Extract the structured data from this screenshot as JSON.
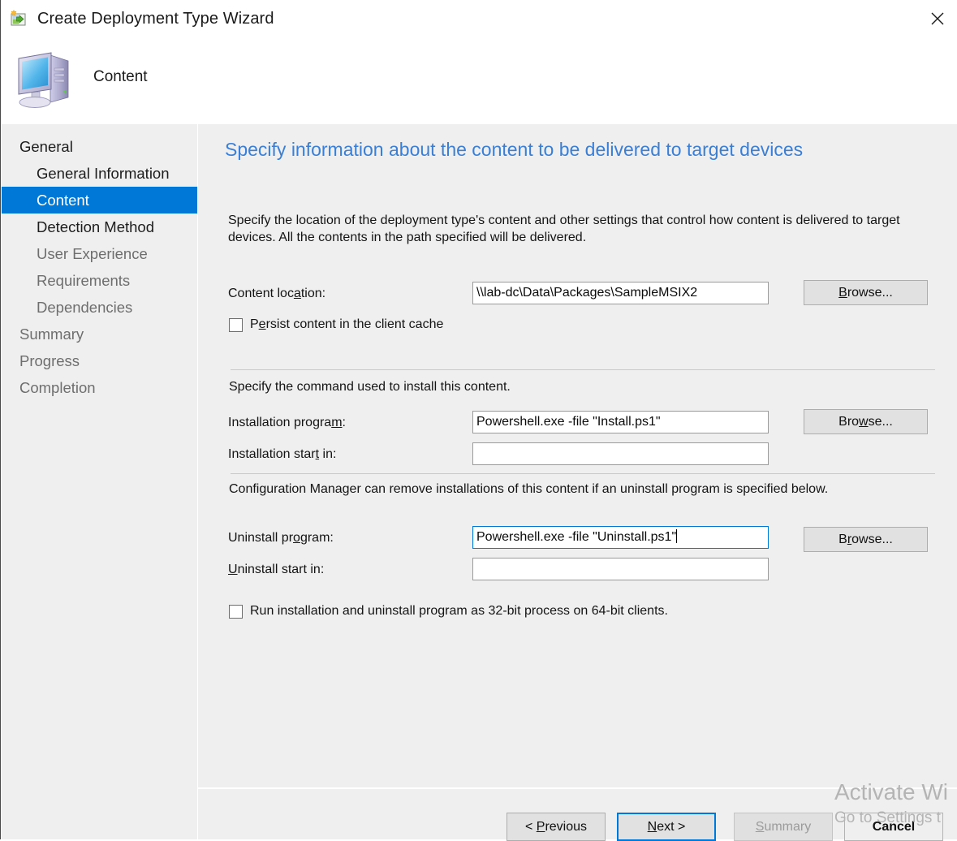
{
  "window": {
    "title": "Create Deployment Type Wizard",
    "title_icon": "deployment-type-icon",
    "close_icon": "close-icon"
  },
  "banner": {
    "icon": "computer-monitor-icon",
    "title": "Content"
  },
  "sidebar": {
    "items": [
      {
        "label": "General",
        "level": 0,
        "state": "normal"
      },
      {
        "label": "General Information",
        "level": 1,
        "state": "normal"
      },
      {
        "label": "Content",
        "level": 1,
        "state": "selected"
      },
      {
        "label": "Detection Method",
        "level": 1,
        "state": "normal"
      },
      {
        "label": "User Experience",
        "level": 1,
        "state": "dim"
      },
      {
        "label": "Requirements",
        "level": 1,
        "state": "dim"
      },
      {
        "label": "Dependencies",
        "level": 1,
        "state": "dim"
      },
      {
        "label": "Summary",
        "level": 0,
        "state": "dim"
      },
      {
        "label": "Progress",
        "level": 0,
        "state": "dim"
      },
      {
        "label": "Completion",
        "level": 0,
        "state": "dim"
      }
    ]
  },
  "main": {
    "heading": "Specify information about the content to be delivered to target devices",
    "intro": "Specify the location of the deployment type's content and other settings that control how content is delivered to target devices. All the contents in the path specified will be delivered.",
    "content_location": {
      "label_pre": "Content loc",
      "label_accel": "a",
      "label_post": "tion:",
      "value": "\\\\lab-dc\\Data\\Packages\\SampleMSIX2",
      "browse_pre": "",
      "browse_accel": "B",
      "browse_post": "rowse..."
    },
    "persist_checkbox": {
      "pre": "P",
      "accel": "e",
      "post": "rsist content in the client cache",
      "checked": false
    },
    "install_section_text": "Specify the command used to install this content.",
    "installation_program": {
      "label_pre": "Installation progra",
      "label_accel": "m",
      "label_post": ":",
      "value": "Powershell.exe -file \"Install.ps1\"",
      "browse_pre": "Bro",
      "browse_accel": "w",
      "browse_post": "se..."
    },
    "installation_start_in": {
      "label_pre": "Installation star",
      "label_accel": "t",
      "label_post": " in:",
      "value": ""
    },
    "uninstall_section_text": "Configuration Manager can remove installations of this content if an uninstall program is specified below.",
    "uninstall_program": {
      "label_pre": "Uninstall pr",
      "label_accel": "o",
      "label_post": "gram:",
      "value": "Powershell.exe -file \"Uninstall.ps1\"",
      "focused": true,
      "browse_pre": "B",
      "browse_accel": "r",
      "browse_post": "owse..."
    },
    "uninstall_start_in": {
      "label_pre": "",
      "label_accel": "U",
      "label_post": "ninstall start in:",
      "value": ""
    },
    "run32_checkbox": {
      "pre": "Run installation and uninstall pro",
      "accel": "g",
      "post": "ram as 32-bit process on 64-bit clients.",
      "checked": false
    }
  },
  "footer": {
    "previous": {
      "pre": "< ",
      "accel": "P",
      "post": "revious"
    },
    "next": {
      "pre": "",
      "accel": "N",
      "post": "ext >"
    },
    "summary": {
      "pre": "",
      "accel": "S",
      "post": "ummary",
      "disabled": true
    },
    "cancel": {
      "pre": "",
      "accel": "",
      "post": "Cancel"
    }
  },
  "watermark": {
    "line1": "Activate Wi",
    "line2": "Go to Settings t"
  },
  "colors": {
    "accent": "#0078d7",
    "heading": "#3a7fd5",
    "panel": "#efefef",
    "watermark": "#b4b4b4"
  }
}
